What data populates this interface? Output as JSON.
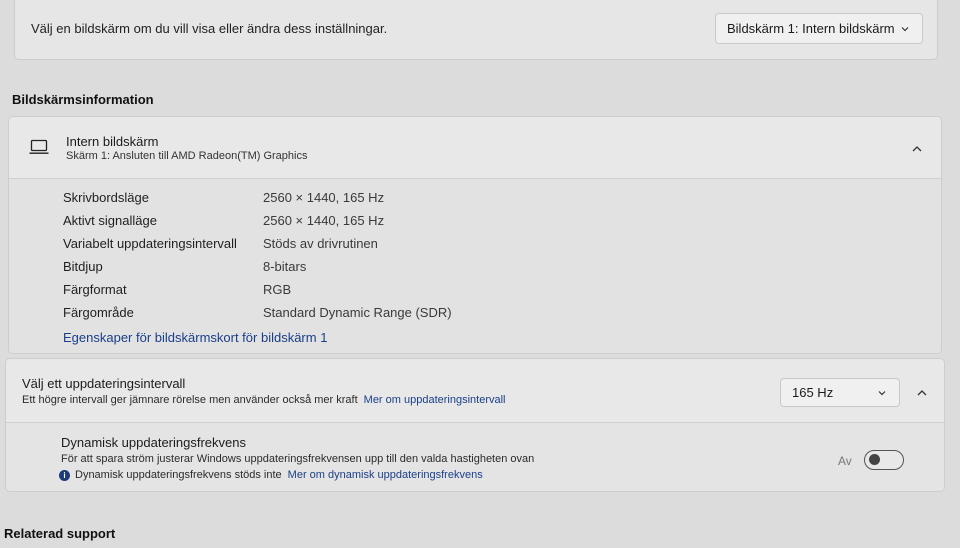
{
  "top": {
    "prompt": "Välj en bildskärm om du vill visa eller ändra dess inställningar.",
    "monitor_select": "Bildskärm 1: Intern bildskärm"
  },
  "display_info": {
    "heading": "Bildskärmsinformation",
    "title": "Intern bildskärm",
    "subtitle": "Skärm 1: Ansluten till AMD Radeon(TM) Graphics",
    "rows": [
      {
        "label": "Skrivbordsläge",
        "value": "2560 × 1440, 165 Hz"
      },
      {
        "label": "Aktivt signalläge",
        "value": "2560 × 1440, 165 Hz"
      },
      {
        "label": "Variabelt uppdateringsintervall",
        "value": "Stöds av drivrutinen"
      },
      {
        "label": "Bitdjup",
        "value": "8-bitars"
      },
      {
        "label": "Färgformat",
        "value": "RGB"
      },
      {
        "label": "Färgområde",
        "value": "Standard Dynamic Range (SDR)"
      }
    ],
    "adapter_link": "Egenskaper för bildskärmskort för bildskärm 1"
  },
  "refresh": {
    "title": "Välj ett uppdateringsintervall",
    "subtitle": "Ett högre intervall ger jämnare rörelse men använder också mer kraft",
    "more_link": "Mer om uppdateringsintervall",
    "selected": "165 Hz",
    "dynamic": {
      "title": "Dynamisk uppdateringsfrekvens",
      "subtitle": "För att spara ström justerar Windows uppdateringsfrekvensen upp till den valda hastigheten ovan",
      "note": "Dynamisk uppdateringsfrekvens stöds inte",
      "note_link": "Mer om dynamisk uppdateringsfrekvens",
      "toggle_label": "Av",
      "toggle_on": false
    }
  },
  "related": {
    "heading": "Relaterad support"
  }
}
